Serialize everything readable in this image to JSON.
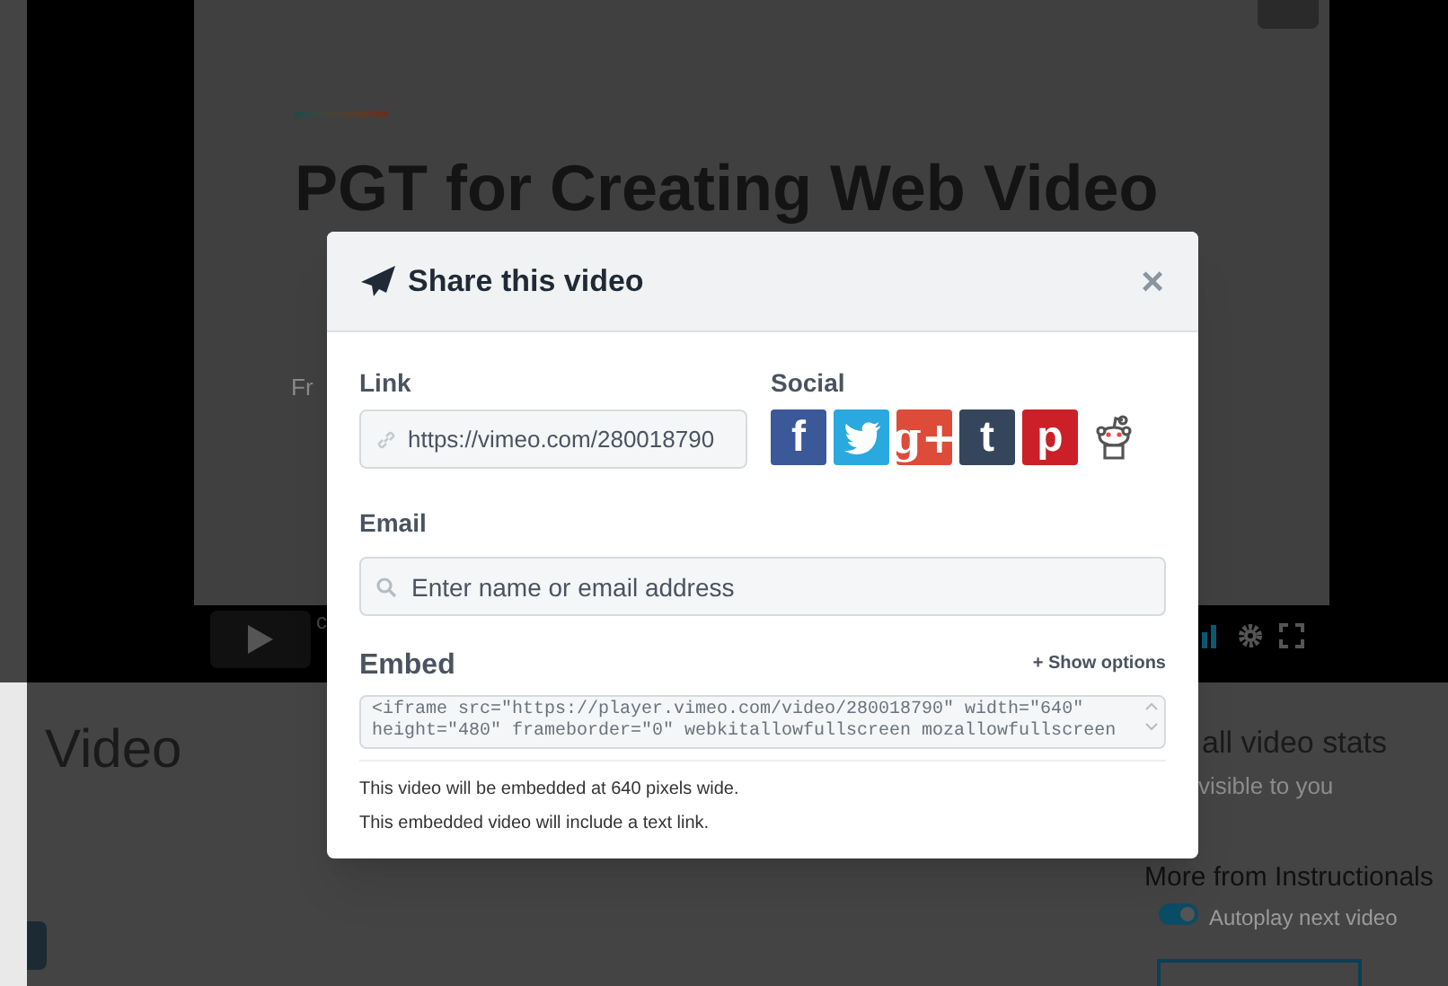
{
  "background": {
    "video_title": "PGT for Creating Web Video",
    "video_text": "Fr",
    "control_text": "c",
    "page_heading": "Video",
    "stats_heading": "all video stats",
    "stats_note": "visible to you",
    "more_heading": "More from Instructionals",
    "autoplay": {
      "label": "Autoplay next video",
      "on": true
    }
  },
  "dialog": {
    "title": "Share this video",
    "close": "×",
    "link": {
      "label": "Link",
      "value": "https://vimeo.com/280018790"
    },
    "social": {
      "label": "Social",
      "items": [
        {
          "kind": "letter",
          "glyph": "f",
          "color": "#3b5998"
        },
        {
          "kind": "bird",
          "color": "#2aa9e0"
        },
        {
          "kind": "letter",
          "glyph": "g+",
          "color": "#dd4b39"
        },
        {
          "kind": "letter",
          "glyph": "t",
          "color": "#35465c"
        },
        {
          "kind": "letter",
          "glyph": "p",
          "color": "#cb2027"
        },
        {
          "kind": "alien",
          "color": "#545454"
        }
      ]
    },
    "email": {
      "label": "Email",
      "placeholder": "Enter name or email address"
    },
    "embed": {
      "label": "Embed",
      "options": "+ Show options",
      "code": "<iframe src=\"https://player.vimeo.com/video/280018790\" width=\"640\"\nheight=\"480\" frameborder=\"0\" webkitallowfullscreen mozallowfullscreen"
    },
    "notes": [
      "This video will be embedded at 640 pixels wide.",
      "This embedded video will include a text link."
    ]
  }
}
